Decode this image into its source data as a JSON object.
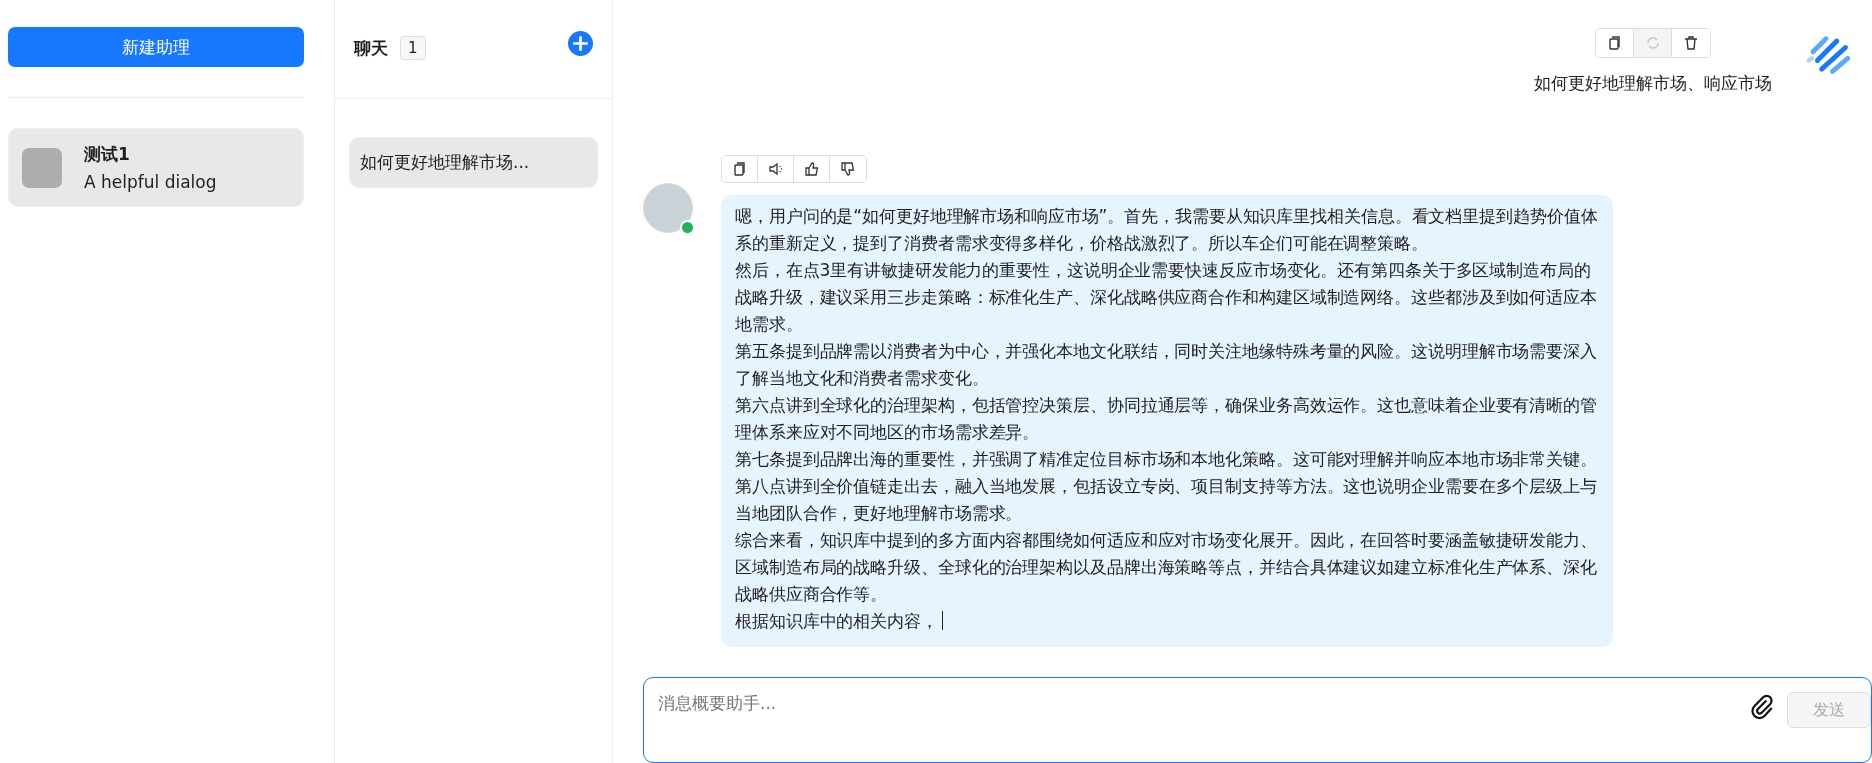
{
  "sidebar": {
    "new_button": "新建助理",
    "assistants": [
      {
        "name": "测试1",
        "description": "A helpful dialog",
        "selected": true
      }
    ]
  },
  "chat_list": {
    "title": "聊天",
    "count": "1",
    "items": [
      {
        "title": "如何更好地理解市场...",
        "selected": true
      }
    ]
  },
  "conversation": {
    "user_message": {
      "text": "如何更好地理解市场、响应市场",
      "actions": [
        {
          "kind": "copy",
          "disabled": false
        },
        {
          "kind": "regenerate",
          "disabled": true
        },
        {
          "kind": "delete",
          "disabled": false
        }
      ]
    },
    "assistant_message": {
      "online": true,
      "streaming": true,
      "actions": [
        {
          "kind": "copy"
        },
        {
          "kind": "speak"
        },
        {
          "kind": "like"
        },
        {
          "kind": "dislike"
        }
      ],
      "paragraphs": [
        "嗯，用户问的是“如何更好地理解市场和响应市场”。首先，我需要从知识库里找相关信息。看文档里提到趋势价值体系的重新定义，提到了消费者需求变得多样化，价格战激烈了。所以车企们可能在调整策略。",
        "然后，在点3里有讲敏捷研发能力的重要性，这说明企业需要快速反应市场变化。还有第四条关于多区域制造布局的战略升级，建议采用三步走策略：标准化生产、深化战略供应商合作和构建区域制造网络。这些都涉及到如何适应本地需求。",
        "第五条提到品牌需以消费者为中心，并强化本地文化联结，同时关注地缘特殊考量的风险。这说明理解市场需要深入了解当地文化和消费者需求变化。",
        "第六点讲到全球化的治理架构，包括管控决策层、协同拉通层等，确保业务高效运作。这也意味着企业要有清晰的管理体系来应对不同地区的市场需求差异。",
        "第七条提到品牌出海的重要性，并强调了精准定位目标市场和本地化策略。这可能对理解并响应本地市场非常关键。",
        "第八点讲到全价值链走出去，融入当地发展，包括设立专岗、项目制支持等方法。这也说明企业需要在多个层级上与当地团队合作，更好地理解市场需求。",
        "综合来看，知识库中提到的多方面内容都围绕如何适应和应对市场变化展开。因此，在回答时要涵盖敏捷研发能力、区域制造布局的战略升级、全球化的治理架构以及品牌出海策略等点，并结合具体建议如建立标准化生产体系、深化战略供应商合作等。",
        "根据知识库中的相关内容，"
      ]
    }
  },
  "composer": {
    "placeholder": "消息概要助手...",
    "send_button": "发送"
  }
}
